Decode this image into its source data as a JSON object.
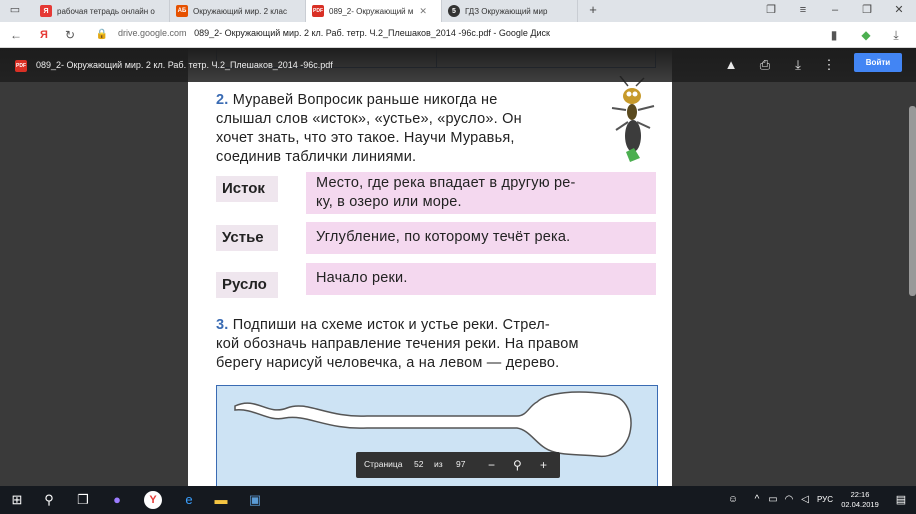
{
  "browser": {
    "tabs": [
      {
        "title": "рабочая тетрадь онлайн о",
        "icon": "yandex-icon",
        "icon_text": "Я",
        "icon_color": "#e53935"
      },
      {
        "title": "Окружающий мир. 2 клас",
        "icon": "ab-icon",
        "icon_text": "АБ",
        "icon_color": "#e65100"
      },
      {
        "title": "089_2- Окружающий м",
        "icon": "pdf-icon",
        "icon_text": "PDF",
        "icon_color": "#d93025"
      },
      {
        "title": "ГДЗ Окружающий мир",
        "icon": "gdz-icon",
        "icon_text": "5",
        "icon_color": "#333333"
      }
    ],
    "new_tab": "+",
    "address": {
      "domain": "drive.google.com",
      "title": "089_2- Окружающий мир. 2 кл. Раб. тетр. Ч.2_Плешаков_2014 -96c.pdf - Google Диск"
    }
  },
  "viewer": {
    "file_title": "089_2- Окружающий мир. 2 кл. Раб. тетр. Ч.2_Плешаков_2014 -96c.pdf",
    "pdf_badge": "PDF",
    "signin_label": "Войти",
    "pagebar": {
      "label": "Страница",
      "current": "52",
      "of": "из",
      "total": "97"
    }
  },
  "page": {
    "task2": {
      "number": "2.",
      "lines": [
        "Муравей Вопросик раньше никогда не",
        "слышал слов «исток», «устье», «русло». Он",
        "хочет знать, что это такое. Научи Муравья,",
        "соединив таблички линиями."
      ]
    },
    "words": [
      "Исток",
      "Устье",
      "Русло"
    ],
    "definitions": [
      [
        "Место, где река впадает в другую ре-",
        "ку, в озеро или море."
      ],
      [
        "Углубление, по которому течёт река."
      ],
      [
        "Начало реки."
      ]
    ],
    "task3": {
      "number": "3.",
      "lines": [
        "Подпиши на схеме исток и устье реки. Стрел-",
        "кой обозначь направление течения реки. На правом",
        "берегу нарисуй человечка, а на левом — дерево."
      ]
    }
  },
  "taskbar": {
    "lang": "РУС",
    "time": "22:16",
    "date": "02.04.2019"
  }
}
